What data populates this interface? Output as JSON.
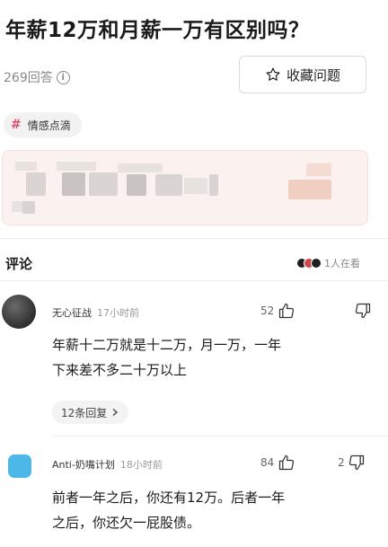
{
  "question": {
    "title": "年薪12万和月薪一万有区别吗？",
    "answers_count": "269回答",
    "collect_label": "收藏问题",
    "tag_label": "情感点滴"
  },
  "comments_section": {
    "title": "评论",
    "likers_label": "1人在看"
  },
  "comments": [
    {
      "user": "无心征战",
      "time": "17小时前",
      "likes": "52",
      "dislikes": "",
      "text_lines": [
        "年薪十二万就是十二万，月一万，一年",
        "下来差不多二十万以上"
      ],
      "replies_label": "12条回复"
    },
    {
      "user": "Anti-奶嘴计划",
      "time": "18小时前",
      "likes": "84",
      "dislikes": "2",
      "text_lines": [
        "前者一年之后，你还有12万。后者一年",
        "之后，你还欠一屁股债。"
      ]
    }
  ],
  "colors": {
    "accent_pink": "#e0506a",
    "card_bg": "#fbf1ef",
    "avatar2_color": "#4db8e8"
  }
}
